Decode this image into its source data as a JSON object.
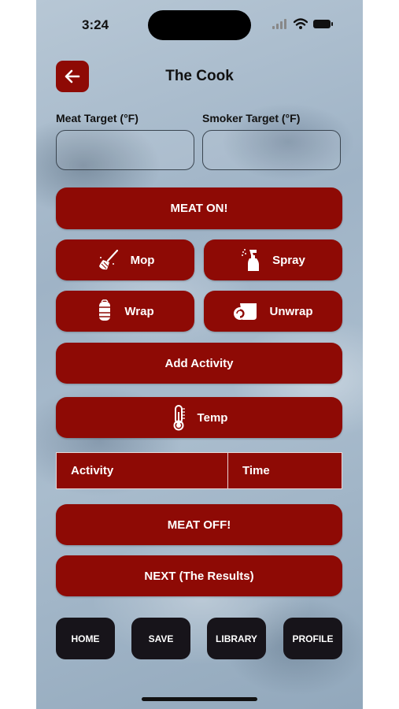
{
  "status_bar": {
    "time": "3:24"
  },
  "header": {
    "title": "The Cook"
  },
  "targets": {
    "meat_label": "Meat Target (°F)",
    "meat_value": "",
    "smoker_label": "Smoker Target (°F)",
    "smoker_value": ""
  },
  "actions": {
    "meat_on": "MEAT ON!",
    "mop": "Mop",
    "spray": "Spray",
    "wrap": "Wrap",
    "unwrap": "Unwrap",
    "add_activity": "Add Activity",
    "temp": "Temp",
    "meat_off": "MEAT OFF!",
    "next": "NEXT (The Results)"
  },
  "activity_table": {
    "columns": [
      "Activity",
      "Time"
    ],
    "rows": []
  },
  "bottom_nav": {
    "home": "HOME",
    "save": "SAVE",
    "library": "LIBRARY",
    "profile": "PROFILE"
  },
  "colors": {
    "accent": "#8e0a05",
    "nav_bg": "#17141a",
    "text": "#111111"
  }
}
